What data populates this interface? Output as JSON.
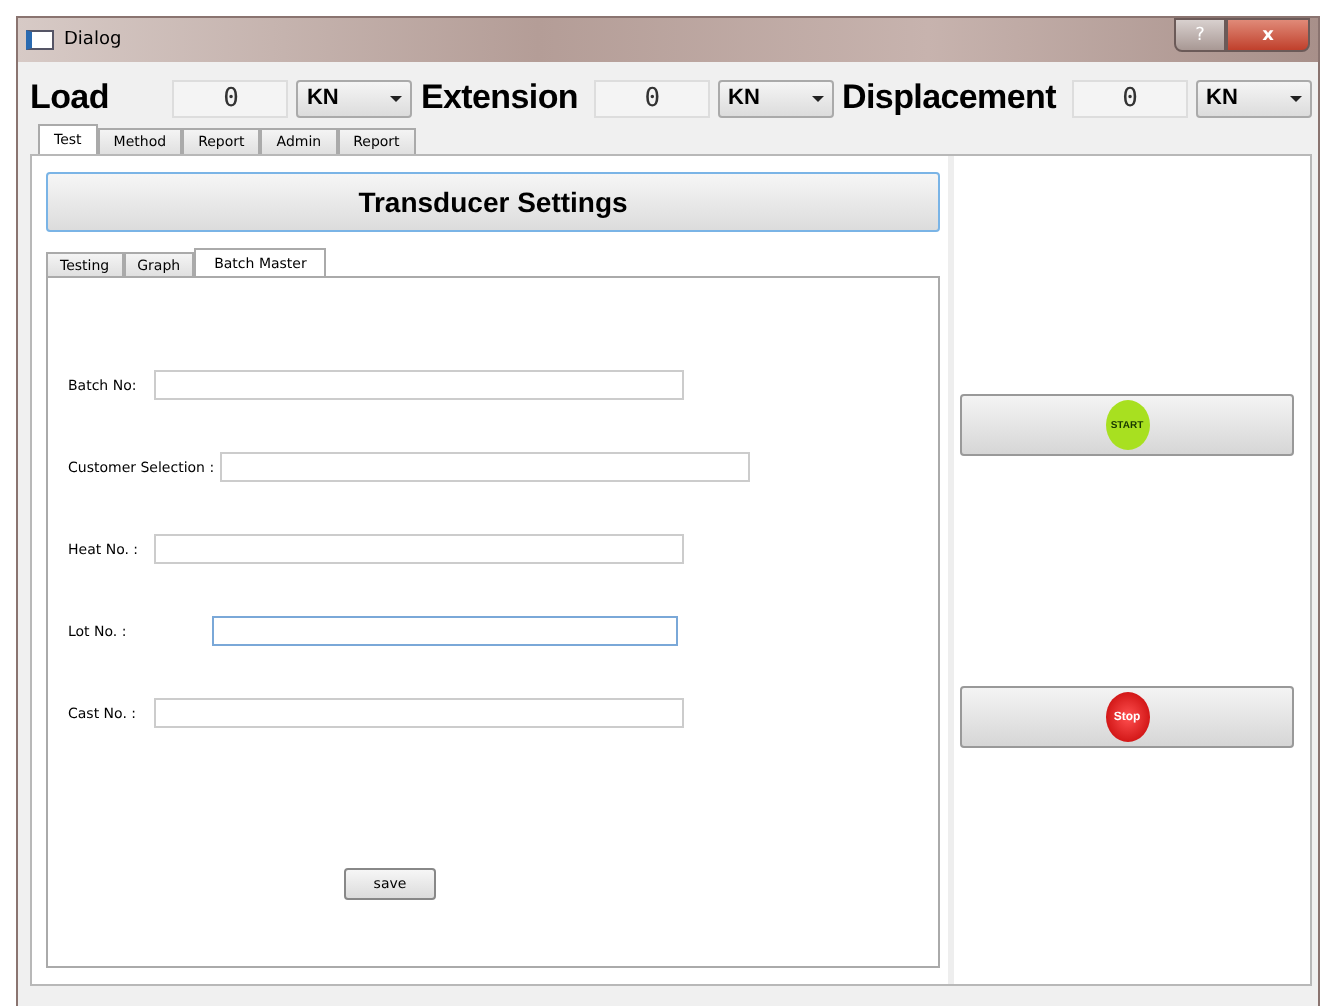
{
  "window": {
    "title": "Dialog",
    "help_button": "?",
    "close_button": "x"
  },
  "readouts": [
    {
      "label": "Load",
      "value": "0",
      "unit": "KN"
    },
    {
      "label": "Extension",
      "value": "0",
      "unit": "KN"
    },
    {
      "label": "Displacement",
      "value": "0",
      "unit": "KN"
    }
  ],
  "tabs": [
    {
      "label": "Test",
      "selected": true
    },
    {
      "label": "Method",
      "selected": false
    },
    {
      "label": "Report",
      "selected": false
    },
    {
      "label": "Admin",
      "selected": false
    },
    {
      "label": "Report",
      "selected": false
    }
  ],
  "header_button": "Transducer Settings",
  "inner_tabs": [
    {
      "label": "Testing",
      "selected": false
    },
    {
      "label": "Graph",
      "selected": false
    },
    {
      "label": "Batch Master",
      "selected": true
    }
  ],
  "fields": [
    {
      "label": "Batch No:",
      "focused": false
    },
    {
      "label": "Customer Selection :",
      "focused": false
    },
    {
      "label": "Heat No. :",
      "focused": false
    },
    {
      "label": "Lot No. :",
      "focused": true
    },
    {
      "label": "Cast No. :",
      "focused": false
    }
  ],
  "save_button": "save",
  "start_button": {
    "icon_text": "START"
  },
  "stop_button": {
    "icon_text": "Stop"
  }
}
